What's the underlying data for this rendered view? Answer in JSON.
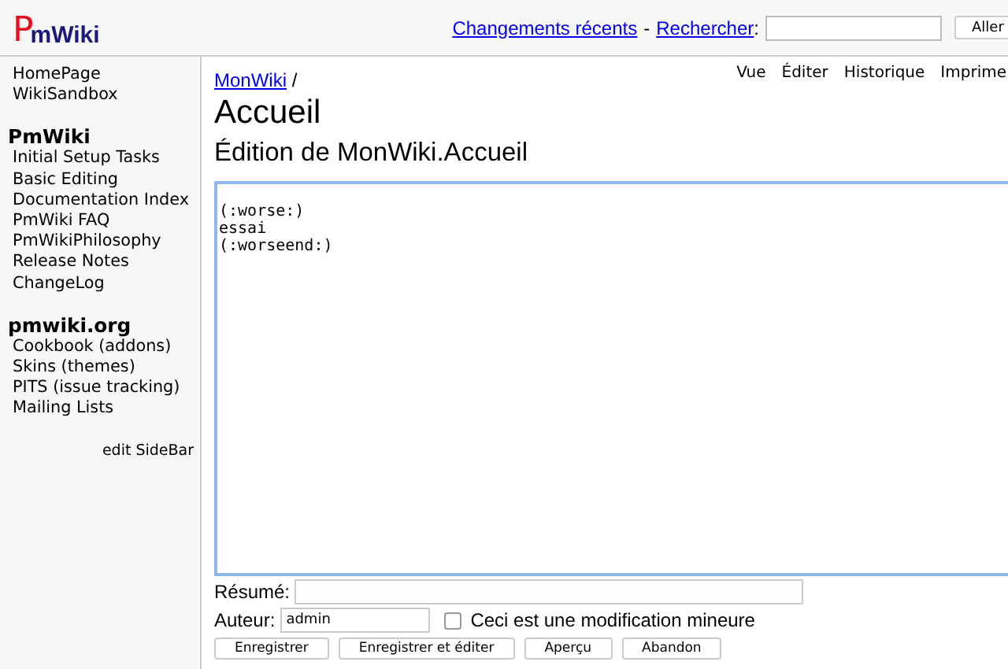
{
  "header": {
    "logo": "PmWiki",
    "links": [
      {
        "label": "Changements récents"
      },
      {
        "label": "Rechercher"
      }
    ],
    "separator": "-",
    "colon": ":",
    "search_button": "Aller"
  },
  "sidebar": {
    "groups": [
      {
        "items": [
          "HomePage",
          "WikiSandbox"
        ]
      },
      {
        "heading": "PmWiki",
        "items": [
          "Initial Setup Tasks",
          "Basic Editing",
          "Documentation Index",
          "PmWiki FAQ",
          "PmWikiPhilosophy",
          "Release Notes",
          "ChangeLog"
        ]
      },
      {
        "heading": "pmwiki.org",
        "items": [
          "Cookbook (addons)",
          "Skins (themes)",
          "PITS (issue tracking)",
          "Mailing Lists"
        ]
      }
    ],
    "edit_link": "edit SideBar"
  },
  "page": {
    "breadcrumb": "MonWiki",
    "breadcrumb_sep": "/",
    "actions": [
      "Vue",
      "Éditer",
      "Historique",
      "Imprime"
    ],
    "title": "Accueil",
    "subtitle": "Édition de MonWiki.Accueil",
    "editor": {
      "lines": [
        "(:worse:)",
        "essai",
        "(:worseend:)"
      ]
    },
    "summary": {
      "label": "Résumé:"
    },
    "author": {
      "label": "Auteur:",
      "value": "admin"
    },
    "minor": {
      "label": "Ceci est une modification mineure",
      "checked": false
    },
    "buttons": [
      "Enregistrer",
      "Enregistrer et éditer",
      "Aperçu",
      "Abandon"
    ]
  }
}
